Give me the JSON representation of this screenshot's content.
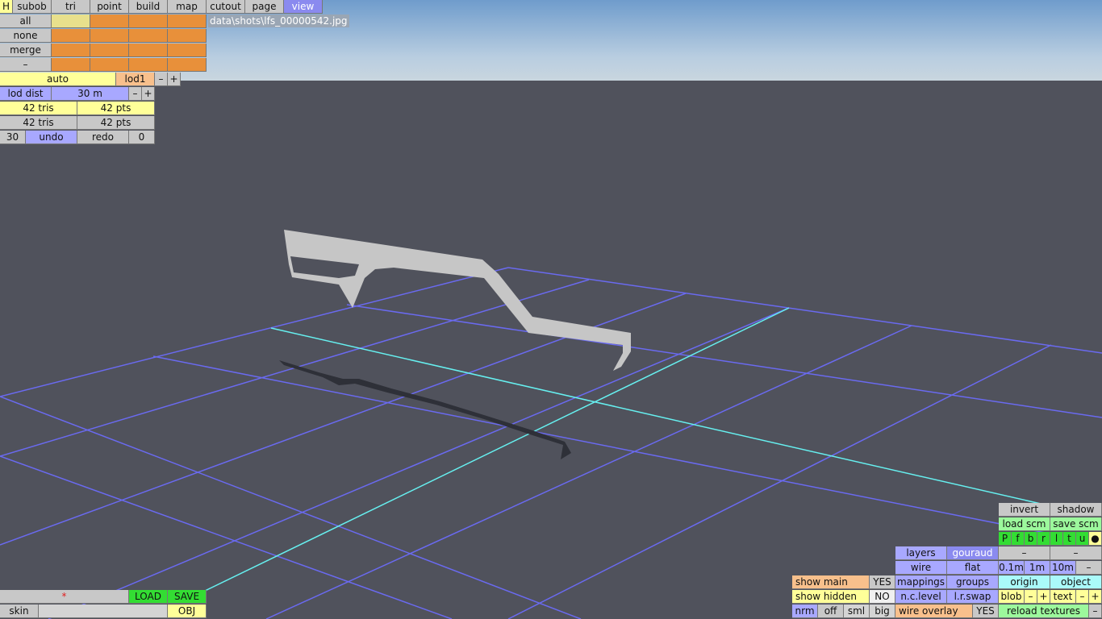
{
  "tabs": {
    "h": "H",
    "subob": "subob",
    "tri": "tri",
    "point": "point",
    "build": "build",
    "map": "map",
    "cutout": "cutout",
    "page": "page",
    "view": "view"
  },
  "selection": {
    "all": "all",
    "none": "none",
    "merge": "merge",
    "dash": "–"
  },
  "filename": "data\\shots\\lfs_00000542.jpg",
  "lod": {
    "auto": "auto",
    "lod1": "lod1",
    "minus": "–",
    "plus": "+",
    "lod_dist": "lod dist",
    "dist_value": "30 m",
    "tris1": "42 tris",
    "pts1": "42 pts",
    "tris2": "42 tris",
    "pts2": "42 pts"
  },
  "history": {
    "count": "30",
    "undo": "undo",
    "redo": "redo",
    "redo_count": "0"
  },
  "file": {
    "star": "*",
    "load": "LOAD",
    "save": "SAVE",
    "skin": "skin",
    "skin_value": "",
    "obj": "OBJ"
  },
  "view_panel": {
    "invert": "invert",
    "shadow": "shadow",
    "load_scm": "load scm",
    "save_scm": "save scm",
    "views": [
      "P",
      "f",
      "b",
      "r",
      "l",
      "t",
      "u",
      "●"
    ],
    "dash1": "–",
    "dash2": "–",
    "grid": [
      "0.1m",
      "1m",
      "10m",
      "–"
    ],
    "origin": "origin",
    "object": "object",
    "blob": "blob",
    "text": "text",
    "minus": "–",
    "plus": "+",
    "reload_textures": "reload textures"
  },
  "render": {
    "layers": "layers",
    "gouraud": "gouraud",
    "wire": "wire",
    "flat": "flat",
    "mappings": "mappings",
    "groups": "groups",
    "nc_level": "n.c.level",
    "lr_swap": "l.r.swap",
    "wire_overlay": "wire overlay",
    "wire_overlay_value": "YES"
  },
  "display": {
    "show_main": "show main",
    "show_main_value": "YES",
    "show_hidden": "show hidden",
    "show_hidden_value": "NO",
    "nrm": "nrm",
    "off": "off",
    "sml": "sml",
    "big": "big"
  },
  "colors": {
    "sky_top": "#6f9ccc",
    "ground": "#50525c",
    "grid": "#6a6af0",
    "axis": "#66f0f0",
    "model": "#c6c6c6",
    "shadow": "#2e3038"
  }
}
